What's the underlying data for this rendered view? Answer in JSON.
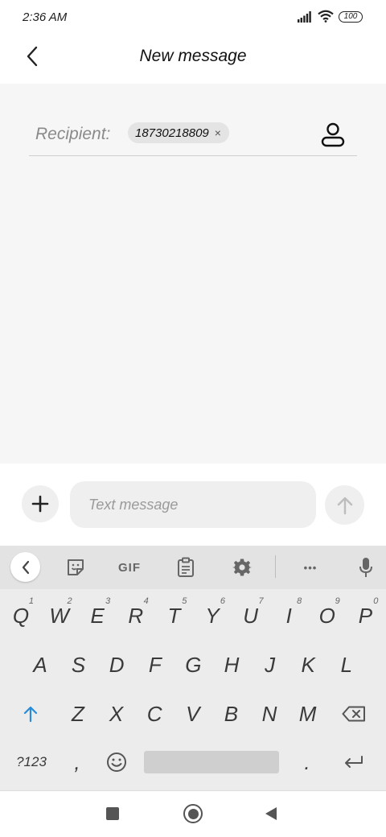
{
  "status_bar": {
    "time": "2:36 AM",
    "battery": "100",
    "icons": [
      "signal-icon",
      "wifi-icon",
      "battery-icon"
    ]
  },
  "header": {
    "title": "New message",
    "back_icon": "chevron-left-icon"
  },
  "recipient": {
    "label": "Recipient:",
    "chip_text": "18730218809",
    "chip_remove": "×",
    "contact_icon": "person-icon"
  },
  "composer": {
    "placeholder": "Text message",
    "value": "",
    "attach_icon": "plus-icon",
    "send_icon": "arrow-up-icon"
  },
  "keyboard_toolbar": {
    "collapse_icon": "chevron-left-icon",
    "sticker_icon": "sticker-icon",
    "gif_label": "GIF",
    "clipboard_icon": "clipboard-icon",
    "settings_icon": "gear-icon",
    "more_label": "•••",
    "mic_icon": "microphone-icon"
  },
  "keyboard": {
    "row1": [
      {
        "label": "Q",
        "hint": "1"
      },
      {
        "label": "W",
        "hint": "2"
      },
      {
        "label": "E",
        "hint": "3"
      },
      {
        "label": "R",
        "hint": "4"
      },
      {
        "label": "T",
        "hint": "5"
      },
      {
        "label": "Y",
        "hint": "6"
      },
      {
        "label": "U",
        "hint": "7"
      },
      {
        "label": "I",
        "hint": "8"
      },
      {
        "label": "O",
        "hint": "9"
      },
      {
        "label": "P",
        "hint": "0"
      }
    ],
    "row2": [
      "A",
      "S",
      "D",
      "F",
      "G",
      "H",
      "J",
      "K",
      "L"
    ],
    "row3": [
      "Z",
      "X",
      "C",
      "V",
      "B",
      "N",
      "M"
    ],
    "symbols_label": "?123",
    "comma_label": ",",
    "period_label": ".",
    "shift_icon": "shift-arrow-icon",
    "backspace_icon": "backspace-icon",
    "emoji_icon": "emoji-icon",
    "enter_icon": "enter-icon",
    "accent_color": "#2a8cd8"
  },
  "nav_bar": {
    "icons": [
      "recent-apps-icon",
      "home-icon",
      "back-triangle-icon"
    ]
  }
}
